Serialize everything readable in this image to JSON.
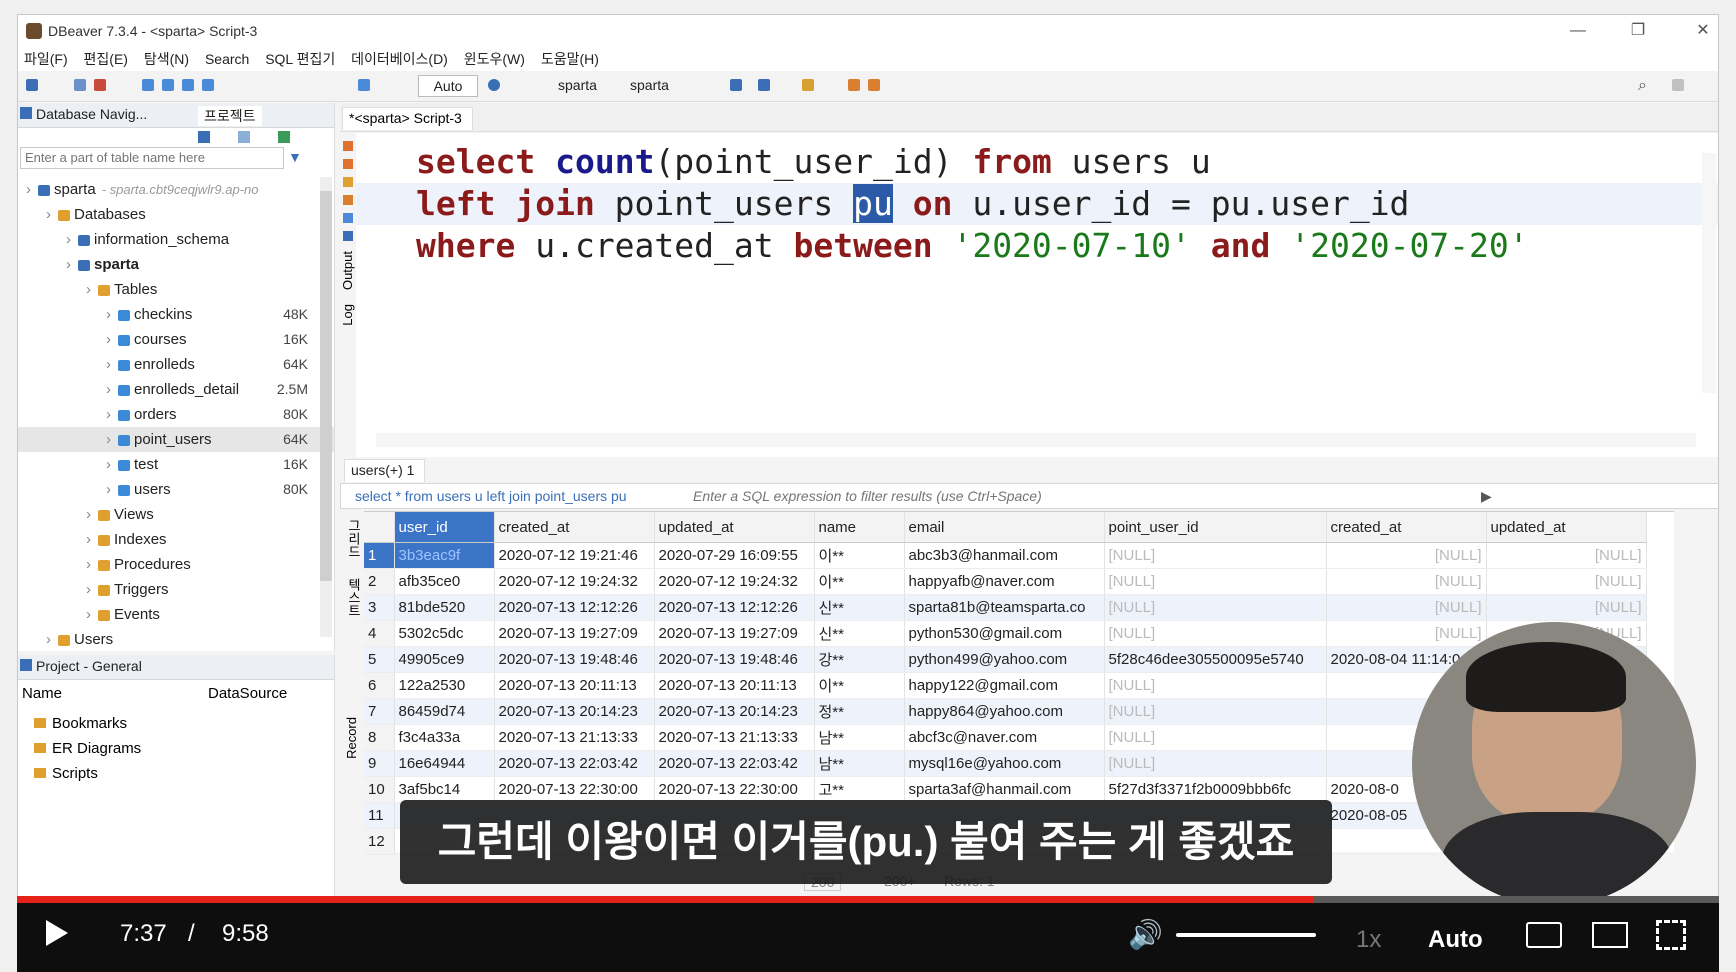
{
  "window": {
    "title": "DBeaver 7.3.4 - <sparta> Script-3",
    "minimize": "—",
    "maximize": "❐",
    "close": "✕"
  },
  "menu": [
    "파일(F)",
    "편집(E)",
    "탐색(N)",
    "Search",
    "SQL 편집기",
    "데이터베이스(D)",
    "윈도우(W)",
    "도움말(H)"
  ],
  "toolbar": {
    "auto": "Auto",
    "db1": "sparta",
    "db2": "sparta"
  },
  "left": {
    "tab_nav": "Database Navig...",
    "tab_proj": "프로젝트",
    "filter_placeholder": "Enter a part of table name here",
    "tree": [
      {
        "label": "sparta",
        "suffix": "- sparta.cbt9ceqjwlr9.ap-no",
        "indent": 0,
        "icon": "db"
      },
      {
        "label": "Databases",
        "indent": 1,
        "icon": "folder"
      },
      {
        "label": "information_schema",
        "indent": 2,
        "icon": "db"
      },
      {
        "label": "sparta",
        "indent": 2,
        "icon": "db",
        "bold": true
      },
      {
        "label": "Tables",
        "indent": 3,
        "icon": "folder"
      },
      {
        "label": "checkins",
        "indent": 4,
        "icon": "table",
        "size": "48K"
      },
      {
        "label": "courses",
        "indent": 4,
        "icon": "table",
        "size": "16K"
      },
      {
        "label": "enrolleds",
        "indent": 4,
        "icon": "table",
        "size": "64K"
      },
      {
        "label": "enrolleds_detail",
        "indent": 4,
        "icon": "table",
        "size": "2.5M"
      },
      {
        "label": "orders",
        "indent": 4,
        "icon": "table",
        "size": "80K"
      },
      {
        "label": "point_users",
        "indent": 4,
        "icon": "table",
        "size": "64K",
        "selected": true
      },
      {
        "label": "test",
        "indent": 4,
        "icon": "table",
        "size": "16K"
      },
      {
        "label": "users",
        "indent": 4,
        "icon": "table",
        "size": "80K"
      },
      {
        "label": "Views",
        "indent": 3,
        "icon": "folder"
      },
      {
        "label": "Indexes",
        "indent": 3,
        "icon": "folder"
      },
      {
        "label": "Procedures",
        "indent": 3,
        "icon": "folder"
      },
      {
        "label": "Triggers",
        "indent": 3,
        "icon": "folder"
      },
      {
        "label": "Events",
        "indent": 3,
        "icon": "folder"
      },
      {
        "label": "Users",
        "indent": 1,
        "icon": "folder"
      }
    ]
  },
  "project": {
    "tab": "Project - General",
    "col_name": "Name",
    "col_ds": "DataSource",
    "items": [
      "Bookmarks",
      "ER Diagrams",
      "Scripts"
    ]
  },
  "editor": {
    "tab": "*<sparta> Script-3",
    "side_output": "Output",
    "side_log": "Log"
  },
  "results": {
    "tab": "users(+) 1",
    "filter_sql": "select * from users u left join point_users pu",
    "filter_placeholder": "Enter a SQL expression to filter results (use Ctrl+Space)",
    "side_grid": "그리드",
    "side_text": "텍스트",
    "side_record": "Record",
    "headers": [
      "user_id",
      "created_at",
      "updated_at",
      "name",
      "email",
      "point_user_id",
      "created_at",
      "updated_at"
    ],
    "rows": [
      [
        "1",
        "3b3eac9f",
        "2020-07-12 19:21:46",
        "2020-07-29 16:09:55",
        "이**",
        "abc3b3@hanmail.com",
        "[NULL]",
        "[NULL]",
        "[NULL]"
      ],
      [
        "2",
        "afb35ce0",
        "2020-07-12 19:24:32",
        "2020-07-12 19:24:32",
        "이**",
        "happyafb@naver.com",
        "[NULL]",
        "[NULL]",
        "[NULL]"
      ],
      [
        "3",
        "81bde520",
        "2020-07-13 12:12:26",
        "2020-07-13 12:12:26",
        "신**",
        "sparta81b@teamsparta.co",
        "[NULL]",
        "[NULL]",
        "[NULL]"
      ],
      [
        "4",
        "5302c5dc",
        "2020-07-13 19:27:09",
        "2020-07-13 19:27:09",
        "신**",
        "python530@gmail.com",
        "[NULL]",
        "[NULL]",
        "[NULL]"
      ],
      [
        "5",
        "49905ce9",
        "2020-07-13 19:48:46",
        "2020-07-13 19:48:46",
        "강**",
        "python499@yahoo.com",
        "5f28c46dee305500095e5740",
        "2020-08-04 11:14:0",
        ""
      ],
      [
        "6",
        "122a2530",
        "2020-07-13 20:11:13",
        "2020-07-13 20:11:13",
        "이**",
        "happy122@gmail.com",
        "[NULL]",
        "",
        ""
      ],
      [
        "7",
        "86459d74",
        "2020-07-13 20:14:23",
        "2020-07-13 20:14:23",
        "정**",
        "happy864@yahoo.com",
        "[NULL]",
        "",
        ""
      ],
      [
        "8",
        "f3c4a33a",
        "2020-07-13 21:13:33",
        "2020-07-13 21:13:33",
        "남**",
        "abcf3c@naver.com",
        "[NULL]",
        "",
        ""
      ],
      [
        "9",
        "16e64944",
        "2020-07-13 22:03:42",
        "2020-07-13 22:03:42",
        "남**",
        "mysql16e@yahoo.com",
        "[NULL]",
        "",
        ""
      ],
      [
        "10",
        "3af5bc14",
        "2020-07-13 22:30:00",
        "2020-07-13 22:30:00",
        "고**",
        "sparta3af@hanmail.com",
        "5f27d3f3371f2b0009bbb6fc",
        "2020-08-0",
        ""
      ],
      [
        "11",
        "",
        "",
        "",
        "",
        "",
        "",
        "2020-08-05",
        ""
      ],
      [
        "12",
        "",
        "",
        "",
        "",
        "",
        "",
        "",
        ""
      ]
    ],
    "status_limit": "200",
    "status_count": "200+",
    "status_rows": "Rows: 1"
  },
  "video": {
    "subtitle": "그런데 이왕이면 이거를(pu.) 붙여 주는 게 좋겠죠",
    "current_time": "7:37",
    "separator": "/",
    "duration": "9:58",
    "progress": 0.762,
    "speed": "1x",
    "quality": "Auto",
    "volume": 1.0
  },
  "colors": {
    "keyword": "#8b1a1a",
    "function": "#1a1a8b",
    "string": "#1a7a1a",
    "selection": "#3c74c8",
    "progress": "#e62117"
  }
}
